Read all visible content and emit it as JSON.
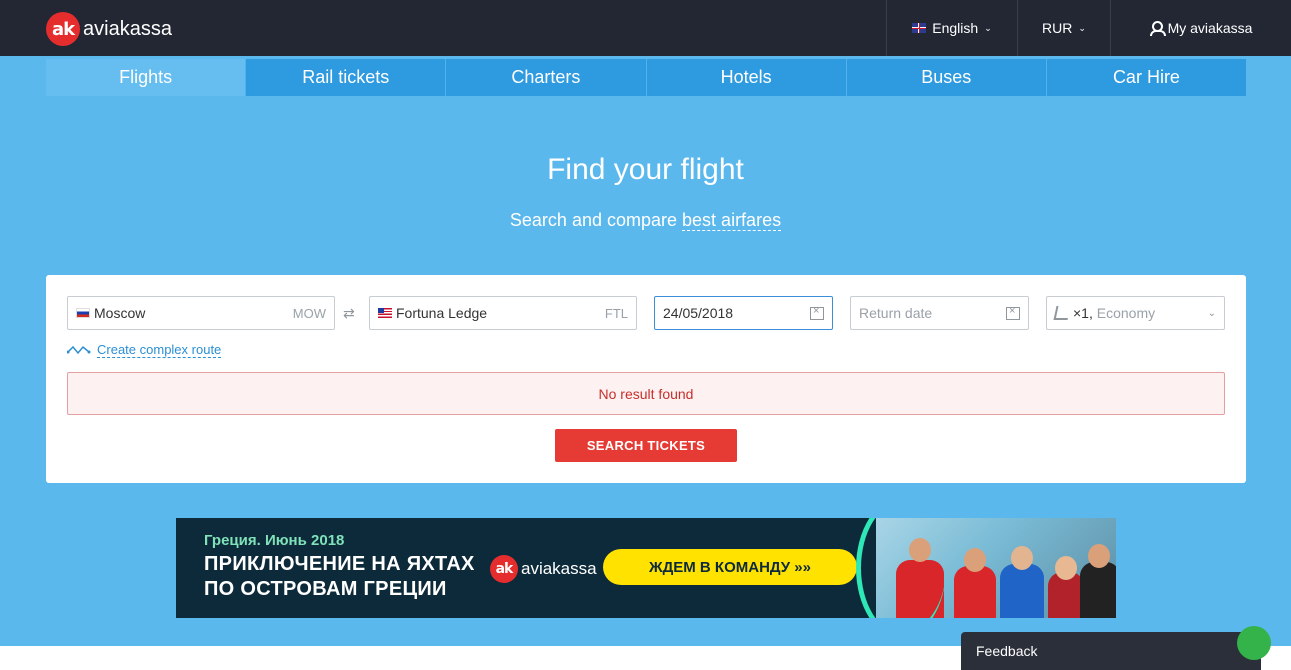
{
  "header": {
    "logo_mark": "ak",
    "logo_text": "aviakassa",
    "language": "English",
    "currency": "RUR",
    "account": "My aviakassa"
  },
  "tabs": [
    {
      "label": "Flights",
      "active": true
    },
    {
      "label": "Rail tickets",
      "active": false
    },
    {
      "label": "Charters",
      "active": false
    },
    {
      "label": "Hotels",
      "active": false
    },
    {
      "label": "Buses",
      "active": false
    },
    {
      "label": "Car Hire",
      "active": false
    }
  ],
  "hero": {
    "title": "Find your flight",
    "subtitle_prefix": "Search and compare",
    "subtitle_link": "best airfares"
  },
  "search": {
    "from_value": "Moscow",
    "from_code": "MOW",
    "to_value": "Fortuna Ledge",
    "to_code": "FTL",
    "depart_date": "24/05/2018",
    "return_placeholder": "Return date",
    "passengers": "×1",
    "cabin": "Economy",
    "complex_route": "Create complex route",
    "error": "No result found",
    "button": "SEARCH TICKETS"
  },
  "banner": {
    "small": "Греция. Июнь 2018",
    "line1": "ПРИКЛЮЧЕНИЕ НА ЯХТАХ",
    "line2": "ПО ОСТРОВАМ ГРЕЦИИ",
    "logo_text": "aviakassa",
    "cta": "ЖДЕМ В КОМАНДУ »»"
  },
  "feedback": {
    "label": "Feedback"
  },
  "colors": {
    "topbar": "#222733",
    "hero": "#5bb8ed",
    "tab": "#2e9ae0",
    "tab_active": "#66bdf0",
    "brand_red": "#e52d2d",
    "button": "#e53b34",
    "banner_bg": "#0d2a3a",
    "banner_cta": "#ffe200"
  }
}
